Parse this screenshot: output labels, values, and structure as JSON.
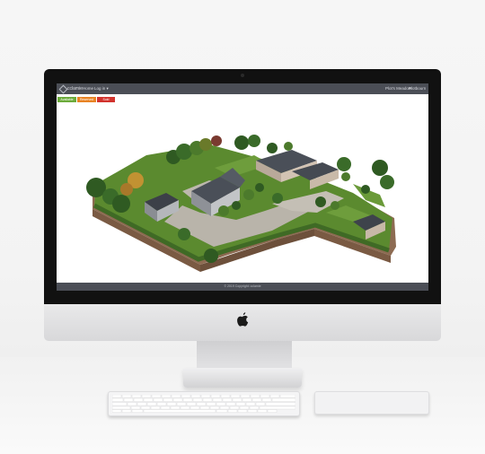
{
  "app": {
    "logo_text": "cclamie",
    "nav": {
      "home": "Home",
      "login": "Log in ▾"
    },
    "nav_right": {
      "link_1": "Plot's Meadow",
      "link_2": "Plotbourn"
    },
    "legend": [
      {
        "label": "Available",
        "color": "#6cab3b"
      },
      {
        "label": "Reserved",
        "color": "#e88324"
      },
      {
        "label": "Sold",
        "color": "#d2332d"
      }
    ],
    "footer": "© 2019 Copyright: cclamie"
  },
  "colors": {
    "navbar": "#4b4e56",
    "screen_bg": "#ffffff",
    "lawn": "#5b8a2f",
    "hedge": "#3f6a25"
  }
}
